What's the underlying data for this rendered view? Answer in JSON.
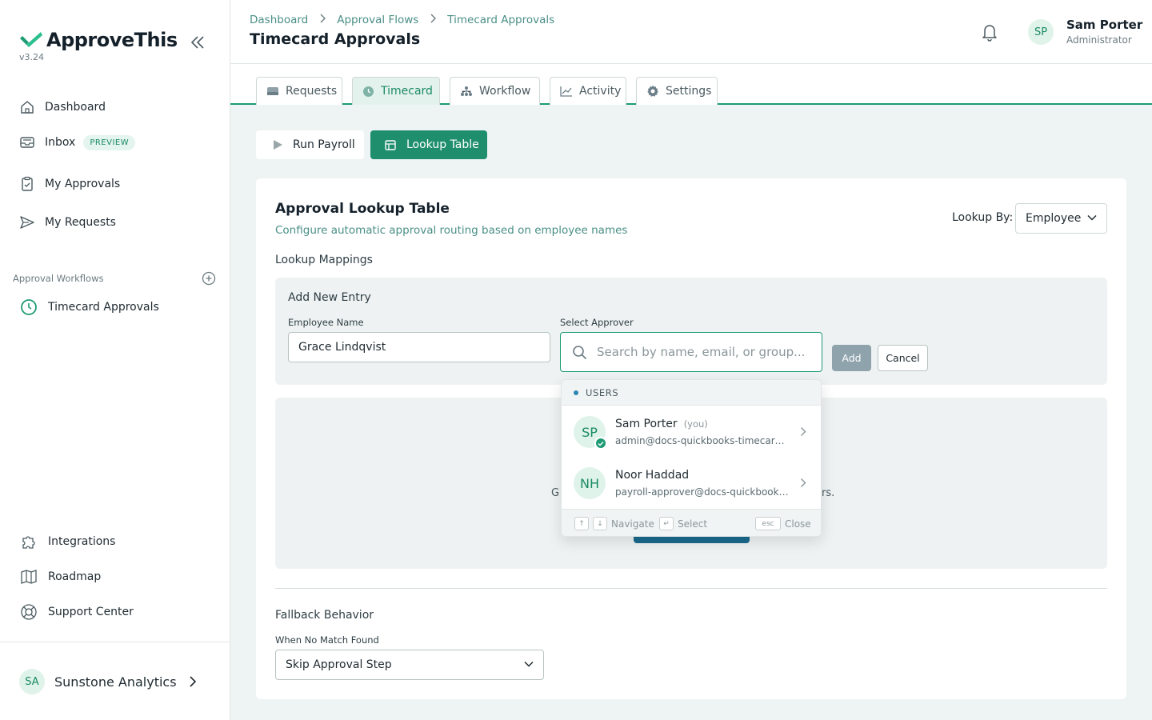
{
  "app": {
    "name": "ApproveThis",
    "version": "v3.24",
    "brand_color": "#1e9a74"
  },
  "sidebar": {
    "nav": [
      {
        "label": "Dashboard",
        "icon": "home-icon"
      },
      {
        "label": "Inbox",
        "icon": "inbox-icon",
        "badge": "PREVIEW"
      },
      {
        "label": "My Approvals",
        "icon": "clipboard-check-icon"
      },
      {
        "label": "My Requests",
        "icon": "send-icon"
      }
    ],
    "section_label": "Approval Workflows",
    "workflows": [
      {
        "label": "Timecard Approvals",
        "icon": "clock-icon"
      }
    ],
    "bottom": [
      {
        "label": "Integrations",
        "icon": "puzzle-icon"
      },
      {
        "label": "Roadmap",
        "icon": "map-icon"
      },
      {
        "label": "Support Center",
        "icon": "lifebuoy-icon"
      }
    ],
    "org": {
      "initials": "SA",
      "name": "Sunstone Analytics"
    }
  },
  "header": {
    "breadcrumb": [
      "Dashboard",
      "Approval Flows",
      "Timecard Approvals"
    ],
    "title": "Timecard Approvals",
    "user": {
      "initials": "SP",
      "name": "Sam Porter",
      "role": "Administrator"
    }
  },
  "tabs": [
    {
      "label": "Requests",
      "icon": "tray-icon",
      "active": false
    },
    {
      "label": "Timecard",
      "icon": "clock-icon",
      "active": true
    },
    {
      "label": "Workflow",
      "icon": "workflow-icon",
      "active": false
    },
    {
      "label": "Activity",
      "icon": "chart-line-icon",
      "active": false
    },
    {
      "label": "Settings",
      "icon": "gear-icon",
      "active": false
    }
  ],
  "actions": {
    "run_payroll": "Run Payroll",
    "lookup_table": "Lookup Table"
  },
  "card": {
    "title": "Approval Lookup Table",
    "subtitle": "Configure automatic approval routing based on employee names",
    "lookup_by_label": "Lookup By:",
    "lookup_by_value": "Employee",
    "mappings_label": "Lookup Mappings",
    "new_entry": {
      "title": "Add New Entry",
      "employee_label": "Employee Name",
      "employee_value": "Grace Lindqvist",
      "approver_label": "Select Approver",
      "approver_placeholder": "Search by name, email, or group...",
      "add_label": "Add",
      "cancel_label": "Cancel"
    },
    "empty_text_left": "G",
    "empty_text_right": "rs.",
    "fallback": {
      "title": "Fallback Behavior",
      "label": "When No Match Found",
      "value": "Skip Approval Step"
    }
  },
  "dropdown": {
    "section": "USERS",
    "users": [
      {
        "initials": "SP",
        "name": "Sam Porter",
        "tag": "(you)",
        "email": "admin@docs-quickbooks-timecard-ro...",
        "verified": true
      },
      {
        "initials": "NH",
        "name": "Noor Haddad",
        "tag": "",
        "email": "payroll-approver@docs-quickbooks-ti...",
        "verified": false
      }
    ],
    "footer": {
      "up_key": "↑",
      "down_key": "↓",
      "navigate": "Navigate",
      "enter_key": "↵",
      "select": "Select",
      "esc_key": "esc",
      "close": "Close"
    }
  }
}
